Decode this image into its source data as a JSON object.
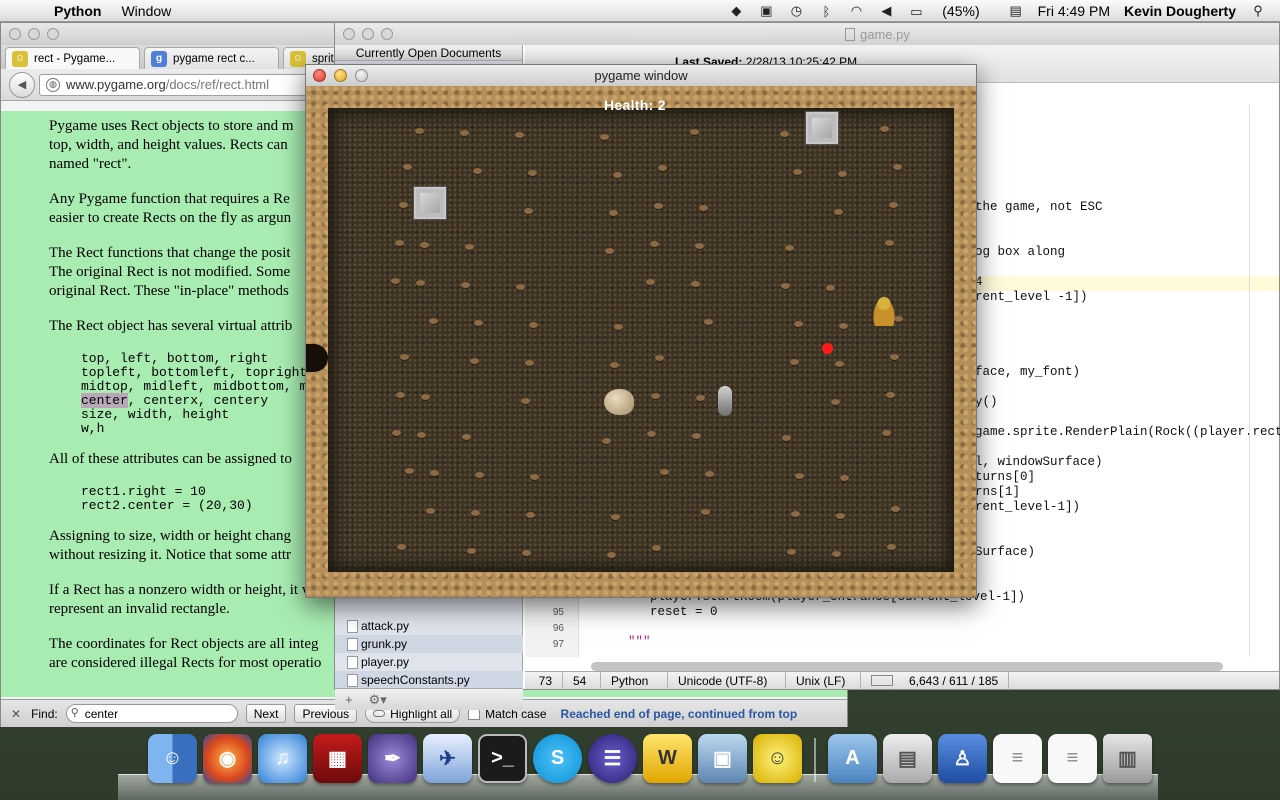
{
  "menubar": {
    "app_name": "Python",
    "menu_window": "Window",
    "battery": "(45%)",
    "clock": "Fri 4:49 PM",
    "user": "Kevin Dougherty"
  },
  "firefox": {
    "tabs": [
      {
        "label": "rect - Pygame...",
        "icon": "pygame-snake-icon"
      },
      {
        "label": "pygame rect c...",
        "icon": "google-icon"
      },
      {
        "label": "sprit",
        "icon": "pygame-snake-icon"
      }
    ],
    "url_host": "www.pygame.org",
    "url_path": "/docs/ref/rect.html",
    "content": {
      "p1_l1": "Pygame uses Rect objects to store and m",
      "p1_l2": "top, width, and height values. Rects can",
      "p1_l3": "named \"rect\".",
      "p2_l1": "Any Pygame function that requires a Re",
      "p2_l2": "easier to create Rects on the fly as argun",
      "p3_l1": "The Rect functions that change the posit",
      "p3_l2": "The original Rect is not modified. Some",
      "p3_l3": "original Rect. These \"in-place\" methods",
      "p4": "The Rect object has several virtual attrib",
      "code1_l1": "top, left, bottom, right",
      "code1_l2": "topleft, bottomleft, topright",
      "code1_l3": "midtop, midleft, midbottom, m",
      "code1_l4_hl": "center",
      "code1_l4_rest": ", centerx, centery",
      "code1_l5": "size, width, height",
      "code1_l6": "w,h",
      "p5": "All of these attributes can be assigned to",
      "code2_l1": "rect1.right = 10",
      "code2_l2": "rect2.center = (20,30)",
      "p6_l1": "Assigning to size, width or height chang",
      "p6_l2": "without resizing it. Notice that some attr",
      "p7_l1": "If a Rect has a nonzero width or height, it w",
      "p7_l2": "represent an invalid rectangle.",
      "p8_l1": "The coordinates for Rect objects are all integ",
      "p8_l2": "are considered illegal Rects for most operatio"
    },
    "findbar": {
      "label": "Find:",
      "value": "center",
      "next": "Next",
      "previous": "Previous",
      "highlight_all": "Highlight all",
      "match_case": "Match case",
      "status": "Reached end of page, continued from top"
    }
  },
  "editor": {
    "title": "game.py",
    "sidebar_header": "Currently Open Documents",
    "last_saved_label": "Last Saved:",
    "last_saved_value": "2/28/13 10:25:42 PM",
    "files": [
      "attack.py",
      "grunk.py",
      "player.py",
      "speechConstants.py"
    ],
    "code_lines": [
      "the game, not ESC",
      "og box along",
      "4",
      "rent_level -1])",
      "face, my_font)",
      "y()",
      "game.sprite.RenderPlain(Rock((player.rect.",
      "l, windowSurface)",
      "turns[0]",
      "rns[1]",
      "rent_level-1])",
      "Surface)",
      "player.startRoom(player_entrance[current_level-1])",
      "reset = 0",
      "\"\"\""
    ],
    "line_numbers": [
      "95",
      "96",
      "97"
    ],
    "status": {
      "line": "73",
      "col": "54",
      "language": "Python",
      "encoding": "Unicode (UTF-8)",
      "line_endings": "Unix (LF)",
      "stats": "6,643 / 611 / 185"
    }
  },
  "pygame": {
    "window_title": "pygame window",
    "health_text": "Health: 2"
  },
  "colors": {
    "page_bg": "#a8ecb2",
    "find_status": "#2a56a3",
    "red_marker": "#ff1a1a"
  },
  "dock": {
    "icons": [
      "finder-icon",
      "firefox-icon",
      "itunes-icon",
      "photo-booth-icon",
      "inkscape-icon",
      "jedit-icon",
      "terminal-icon",
      "skype-icon",
      "eclipse-icon",
      "wing-ide-icon",
      "iphoto-icon",
      "python-icon",
      "applications-folder-icon",
      "preview-icon",
      "downloads-icon",
      "document-icon",
      "document-icon",
      "trash-icon"
    ]
  }
}
